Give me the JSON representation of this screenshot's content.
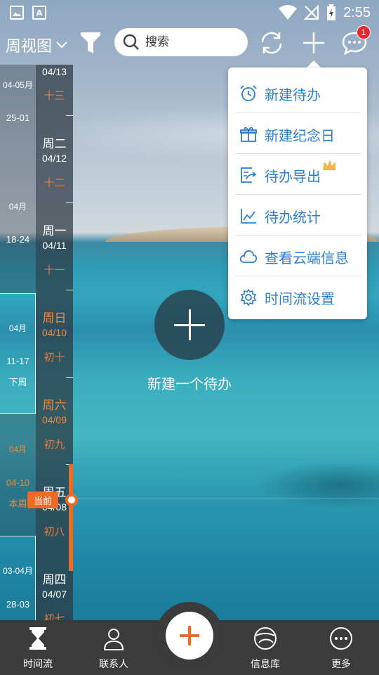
{
  "status_bar": {
    "time": "2:55"
  },
  "toolbar": {
    "view_label": "周视图",
    "search_placeholder": "搜索",
    "notification_count": "1"
  },
  "week_column": {
    "items": [
      {
        "range": "04-05月"
      },
      {
        "range": "25-01"
      },
      {
        "range": "04月"
      },
      {
        "range": "18-24"
      },
      {
        "range": "04月"
      },
      {
        "range": "11-17"
      },
      {
        "range": "下周"
      },
      {
        "range": "04月"
      },
      {
        "range": "04-10"
      },
      {
        "range": "本周"
      },
      {
        "range": "03-04月"
      },
      {
        "range": "28-03"
      }
    ]
  },
  "day_column": {
    "days": [
      {
        "weekday": "",
        "date": "04/13",
        "lunar": "十三"
      },
      {
        "weekday": "周二",
        "date": "04/12",
        "lunar": "十二"
      },
      {
        "weekday": "周一",
        "date": "04/11",
        "lunar": "十一"
      },
      {
        "weekday": "周日",
        "date": "04/10",
        "lunar": "初十"
      },
      {
        "weekday": "周六",
        "date": "04/09",
        "lunar": "初九"
      },
      {
        "weekday": "周五",
        "date": "04/08",
        "lunar": "初八"
      },
      {
        "weekday": "周四",
        "date": "04/07",
        "lunar": "初七"
      }
    ],
    "now_tag": "当前"
  },
  "center": {
    "label": "新建一个待办"
  },
  "menu": {
    "items": [
      {
        "label": "新建待办",
        "icon": "alarm-clock-icon"
      },
      {
        "label": "新建纪念日",
        "icon": "gift-icon"
      },
      {
        "label": "待办导出",
        "icon": "export-icon"
      },
      {
        "label": "待办统计",
        "icon": "line-chart-icon"
      },
      {
        "label": "查看云端信息",
        "icon": "cloud-icon"
      },
      {
        "label": "时间流设置",
        "icon": "gear-icon"
      }
    ]
  },
  "bottom_nav": {
    "items": [
      {
        "label": "时间流",
        "icon": "hourglass-icon"
      },
      {
        "label": "联系人",
        "icon": "person-icon"
      },
      {
        "label": "信息库",
        "icon": "database-icon"
      },
      {
        "label": "更多",
        "icon": "more-dots-icon"
      }
    ]
  },
  "colors": {
    "accent": "#ee6a25",
    "menu_text": "#2b7fd0",
    "nav_bg": "#3b3b3b",
    "badge": "#e8282b"
  }
}
